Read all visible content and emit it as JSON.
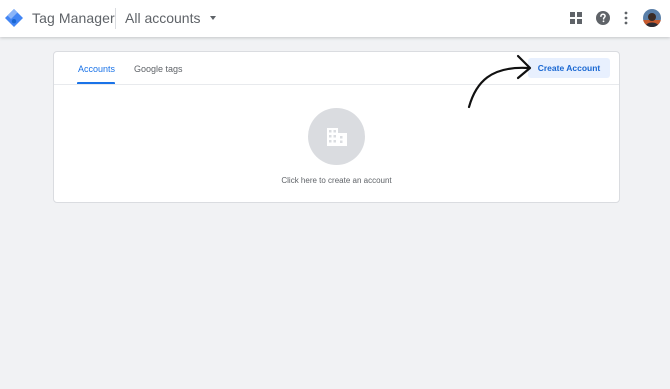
{
  "header": {
    "product_name": "Tag Manager",
    "account_switcher": "All accounts",
    "icons": [
      "apps-grid-icon",
      "help-icon",
      "more-vert-icon"
    ]
  },
  "tabs": [
    {
      "label": "Accounts",
      "active": true
    },
    {
      "label": "Google tags",
      "active": false
    }
  ],
  "actions": {
    "create_account": "Create Account"
  },
  "empty_state": {
    "message": "Click here to create an account",
    "icon": "building-icon"
  },
  "colors": {
    "accent": "#1a73e8",
    "button_bg": "#e8f0fe",
    "background": "#f1f2f4"
  }
}
